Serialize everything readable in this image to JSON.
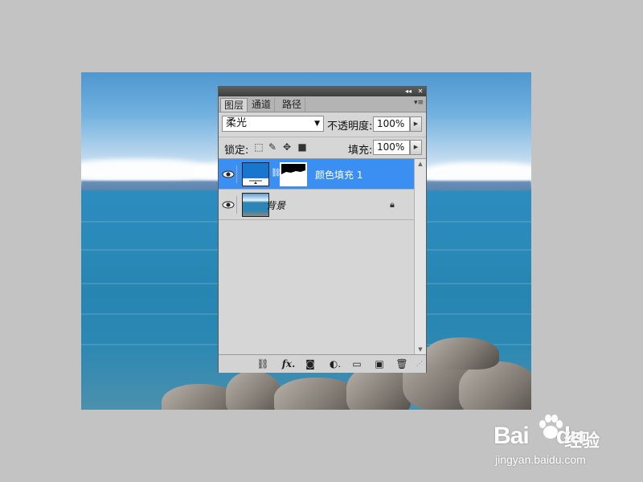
{
  "panel": {
    "tabs": [
      "图层",
      "通道",
      "路径"
    ],
    "active_tab": 0,
    "blend_mode": "柔光",
    "opacity_label": "不透明度:",
    "opacity_value": "100%",
    "lock_label": "锁定:",
    "fill_label": "填充:",
    "fill_value": "100%",
    "layers": [
      {
        "name": "颜色填充 1",
        "selected": true,
        "visible": true,
        "type": "fill-with-mask"
      },
      {
        "name": "背景",
        "selected": false,
        "visible": true,
        "locked": true,
        "type": "image"
      }
    ],
    "bottom_icons": [
      "link-layers-icon",
      "fx-icon",
      "add-mask-icon",
      "adjustment-layer-icon",
      "new-group-icon",
      "new-layer-icon",
      "trash-icon"
    ]
  },
  "watermark": {
    "brand": "Bai",
    "brand2": "du",
    "cn": "经验",
    "url": "jingyan.baidu.com"
  },
  "colors": {
    "selection": "#3c8ff2",
    "fill_swatch": "#1976cf",
    "workspace": "#c3c3c3"
  }
}
